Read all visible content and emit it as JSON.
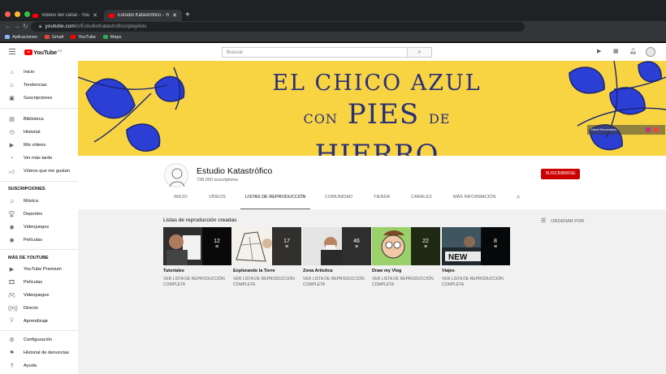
{
  "browser": {
    "tabs": [
      {
        "title": "Videos del canal - YouTube Stu"
      },
      {
        "title": "Estudio Katastrófico - YouTube"
      }
    ],
    "url_host": "youtube.com",
    "url_path": "/c/EstudioKatastrofico/playlists",
    "bookmarks": [
      {
        "label": "Aplicaciones",
        "icon": "apps-grid-icon",
        "color": "#8ab4f8"
      },
      {
        "label": "Gmail",
        "icon": "gmail-icon",
        "color": "#ea4335"
      },
      {
        "label": "YouTube",
        "icon": "youtube-icon",
        "color": "#ff0000"
      },
      {
        "label": "Maps",
        "icon": "maps-icon",
        "color": "#34a853"
      }
    ]
  },
  "youtube": {
    "logo_text": "YouTube",
    "logo_region": "ES",
    "search_placeholder": "Buscar",
    "sidebar": {
      "main": [
        {
          "label": "Inicio",
          "icon": "home-icon"
        },
        {
          "label": "Tendencias",
          "icon": "trending-icon"
        },
        {
          "label": "Suscripciones",
          "icon": "subscriptions-icon"
        }
      ],
      "library": [
        {
          "label": "Biblioteca",
          "icon": "library-icon"
        },
        {
          "label": "Historial",
          "icon": "history-icon"
        },
        {
          "label": "Mis vídeos",
          "icon": "my-videos-icon"
        },
        {
          "label": "Ver más tarde",
          "icon": "watch-later-icon"
        },
        {
          "label": "Vídeos que me gustan",
          "icon": "liked-icon"
        }
      ],
      "subscriptions_heading": "SUSCRIPCIONES",
      "subscriptions": [
        {
          "label": "Música",
          "icon": "music-icon"
        },
        {
          "label": "Deportes",
          "icon": "sports-icon"
        },
        {
          "label": "Videojuegos",
          "icon": "gaming-icon"
        },
        {
          "label": "Películas",
          "icon": "movies-icon"
        }
      ],
      "more_heading": "MÁS DE YOUTUBE",
      "more": [
        {
          "label": "YouTube Premium",
          "icon": "youtube-premium-icon"
        },
        {
          "label": "Películas",
          "icon": "movies-icon"
        },
        {
          "label": "Videojuegos",
          "icon": "gaming-icon"
        },
        {
          "label": "Directo",
          "icon": "live-icon"
        },
        {
          "label": "Aprendizaje",
          "icon": "learning-icon"
        }
      ],
      "settings": [
        {
          "label": "Configuración",
          "icon": "settings-gear-icon"
        },
        {
          "label": "Historial de denuncias",
          "icon": "report-flag-icon"
        },
        {
          "label": "Ayuda",
          "icon": "help-icon"
        }
      ]
    },
    "banner": {
      "line1": "EL CHICO AZUL",
      "line2_small": "CON",
      "line2_big": "PIES",
      "line2_small2": "DE",
      "line2_big2": "HIERRO",
      "social_label": "Canal Secundario",
      "bg_color": "#f8d443",
      "ink_color": "#2a2f7a"
    },
    "channel": {
      "name": "Estudio Katastrófico",
      "subscribers": "738.000 suscriptores",
      "subscribe_label": "SUSCRIBIRSE",
      "tabs": [
        "INICIO",
        "VÍDEOS",
        "LISTAS DE REPRODUCCIÓN",
        "COMUNIDAD",
        "TIENDA",
        "CANALES",
        "MÁS INFORMACIÓN"
      ],
      "active_tab": "LISTAS DE REPRODUCCIÓN"
    },
    "playlists_section": {
      "title": "Listas de reproducción creadas",
      "sort_label": "ORDENAR POR",
      "view_all_label": "VER LISTA DE REPRODUCCIÓN COMPLETA",
      "items": [
        {
          "title": "Tutoriales",
          "count": "12"
        },
        {
          "title": "Explorando la Torre",
          "count": "17"
        },
        {
          "title": "Zona Artística",
          "count": "46"
        },
        {
          "title": "Draw my Vlog",
          "count": "22"
        },
        {
          "title": "Viajes",
          "count": "8"
        }
      ]
    }
  }
}
